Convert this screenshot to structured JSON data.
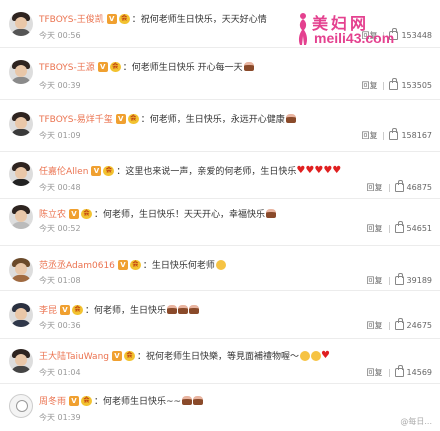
{
  "watermark": {
    "cn": "美妇网",
    "url": "meili43.com"
  },
  "bottom_watermark": "@每日...",
  "reply_label": "回复",
  "comments": [
    {
      "user": "TFBOYS-王俊凯",
      "text": "：祝何老师生日快乐，天天好心情",
      "time": "今天 00:56",
      "likes": "153448",
      "extra": ""
    },
    {
      "user": "TFBOYS-王源",
      "text": "：何老师生日快乐 开心每一天",
      "time": "今天 00:39",
      "likes": "153505",
      "extra": "cake1"
    },
    {
      "user": "TFBOYS-易烊千玺",
      "text": "：何老师，生日快乐，永远开心健康",
      "time": "今天 01:09",
      "likes": "158167",
      "extra": "cake1"
    },
    {
      "user": "任嘉伦Allen",
      "text": "：这里也来说一声，亲爱的何老师，生日快乐",
      "time": "今天 00:48",
      "likes": "46875",
      "extra": "hearts"
    },
    {
      "user": "陈立农",
      "text": "：何老师，生日快乐！天天开心，幸福快乐",
      "time": "今天 00:52",
      "likes": "54651",
      "extra": "cake1"
    },
    {
      "user": "范丞丞Adam0616",
      "text": "：生日快乐何老师",
      "time": "今天 01:08",
      "likes": "39189",
      "extra": "smile"
    },
    {
      "user": "李昆",
      "text": "：何老师，生日快乐",
      "time": "今天 00:36",
      "likes": "24675",
      "extra": "cakes3"
    },
    {
      "user": "王大陆TaiuWang",
      "text": "：祝何老师生日快樂，等見面補禮物喔～",
      "time": "今天 01:04",
      "likes": "14569",
      "extra": "smileheart"
    },
    {
      "user": "周冬雨",
      "text": "：何老师生日快乐~~",
      "time": "今天 01:39",
      "likes": "",
      "extra": "cakes2"
    }
  ],
  "colors": {
    "username": "#eb7350",
    "watermark": "#e4418f",
    "heart": "#e02020"
  }
}
